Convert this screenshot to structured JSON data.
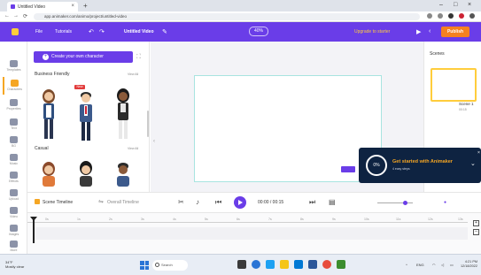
{
  "browser": {
    "tab_title": "Untitled Video",
    "tab_close": "×",
    "new_tab": "+",
    "url": "app.animaker.com/animo/project/untitled-video",
    "controls": {
      "minimize": "–",
      "maximize": "□",
      "close": "×"
    },
    "nav": {
      "back": "←",
      "forward": "→",
      "reload": "⟳"
    }
  },
  "header": {
    "menu_file": "File",
    "menu_tutorials": "Tutorials",
    "video_title": "Untitled Video",
    "zoom": "40%",
    "upgrade": "Upgrade to starter",
    "publish": "Publish"
  },
  "left_nav": {
    "items": [
      {
        "label": "Templates"
      },
      {
        "label": "Characters"
      },
      {
        "label": "Properties"
      },
      {
        "label": "Text"
      },
      {
        "label": "BG"
      },
      {
        "label": "Music"
      },
      {
        "label": "Effects"
      },
      {
        "label": "Upload"
      },
      {
        "label": "Video"
      },
      {
        "label": "Images"
      },
      {
        "label": "More"
      }
    ]
  },
  "panel": {
    "create_button": "Create your own character",
    "section1": "Business Friendly",
    "section2": "Casual",
    "view_all": "View All",
    "new_badge": "New"
  },
  "scenes": {
    "title": "Scenes",
    "scene_name": "Scene 1",
    "scene_duration": "00:15"
  },
  "toast": {
    "progress": "0%",
    "title": "Get started with Animaker",
    "subtitle": "4 easy steps",
    "close": "×",
    "chevron": "⌄"
  },
  "timeline": {
    "tab_scene": "Scene Timeline",
    "tab_overall": "Overall Timeline",
    "timecode": "00:00 / 00:15",
    "ticks": [
      "0s",
      "1s",
      "2s",
      "3s",
      "4s",
      "5s",
      "6s",
      "7s",
      "8s",
      "9s",
      "10s",
      "11s",
      "12s",
      "13s"
    ],
    "zoom_plus": "+",
    "zoom_minus": "–"
  },
  "taskbar": {
    "weather_temp": "34°F",
    "weather_desc": "Mostly clear",
    "search": "Search",
    "time": "4:21 PM",
    "date": "12/18/2022",
    "lang": "ENG"
  },
  "colors": {
    "brand": "#6a3de8",
    "accent": "#f58120",
    "highlight": "#ffcd3c",
    "toast_bg": "#0e2341"
  }
}
